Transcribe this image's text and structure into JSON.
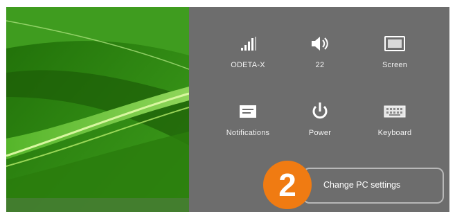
{
  "quick_settings": {
    "tiles": [
      {
        "label": "ODETA-X",
        "icon": "wifi-signal-icon"
      },
      {
        "label": "22",
        "icon": "volume-icon"
      },
      {
        "label": "Screen",
        "icon": "screen-brightness-icon"
      },
      {
        "label": "Notifications",
        "icon": "notifications-icon"
      },
      {
        "label": "Power",
        "icon": "power-icon"
      },
      {
        "label": "Keyboard",
        "icon": "keyboard-icon"
      }
    ],
    "change_settings_label": "Change PC settings"
  },
  "callout": {
    "step_number": "2",
    "color": "#f07b12"
  },
  "colors": {
    "panel_bg": "#6d6d6d",
    "wallpaper_green": "#2f8a12"
  }
}
